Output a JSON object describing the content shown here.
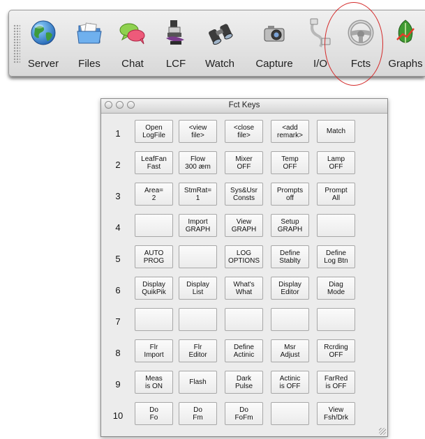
{
  "toolbar": {
    "items": [
      {
        "label": "Server",
        "icon": "globe-icon"
      },
      {
        "label": "Files",
        "icon": "folder-icon"
      },
      {
        "label": "Chat",
        "icon": "chat-bubbles-icon"
      },
      {
        "label": "LCF",
        "icon": "leaf-chamber-icon"
      },
      {
        "label": "Watch",
        "icon": "binoculars-icon"
      },
      {
        "label": "Capture",
        "icon": "camera-icon"
      },
      {
        "label": "I/O",
        "icon": "cable-icon"
      },
      {
        "label": "Fcts",
        "icon": "steering-wheel-icon"
      },
      {
        "label": "Graphs",
        "icon": "graph-leaf-icon"
      }
    ],
    "highlight_color": "#d42a2a"
  },
  "window": {
    "title": "Fct Keys",
    "rows": [
      {
        "num": "1",
        "keys": [
          "Open\nLogFile",
          "<view\nfile>",
          "<close\nfile>",
          "<add\nremark>",
          "Match"
        ]
      },
      {
        "num": "2",
        "keys": [
          "LeafFan\nFast",
          "Flow\n300 æm",
          "Mixer\nOFF",
          "Temp\nOFF",
          "Lamp\nOFF"
        ]
      },
      {
        "num": "3",
        "keys": [
          "Area=\n2",
          "StmRat=\n1",
          "Sys&Usr\nConsts",
          "Prompts\noff",
          "Prompt\nAll"
        ]
      },
      {
        "num": "4",
        "keys": [
          "",
          "Import\nGRAPH",
          "View\nGRAPH",
          "Setup\nGRAPH",
          ""
        ]
      },
      {
        "num": "5",
        "keys": [
          "AUTO\nPROG",
          "",
          "LOG\nOPTIONS",
          "Define\nStablty",
          "Define\nLog Btn"
        ]
      },
      {
        "num": "6",
        "keys": [
          "Display\nQuikPik",
          "Display\nList",
          "What's\nWhat",
          "Display\nEditor",
          "Diag\nMode"
        ]
      },
      {
        "num": "7",
        "keys": [
          "",
          "",
          "",
          "",
          ""
        ]
      },
      {
        "num": "8",
        "keys": [
          "Flr\nImport",
          "Flr\nEditor",
          "Define\nActinic",
          "Msr\nAdjust",
          "Rcrding\nOFF"
        ]
      },
      {
        "num": "9",
        "keys": [
          "Meas\nis ON",
          "Flash",
          "Dark\nPulse",
          "Actinic\nis OFF",
          "FarRed\nis OFF"
        ]
      },
      {
        "num": "10",
        "keys": [
          "Do\nFo",
          "Do\nFm",
          "Do\nFoFm",
          "",
          "View\nFsh/Drk"
        ]
      }
    ]
  }
}
